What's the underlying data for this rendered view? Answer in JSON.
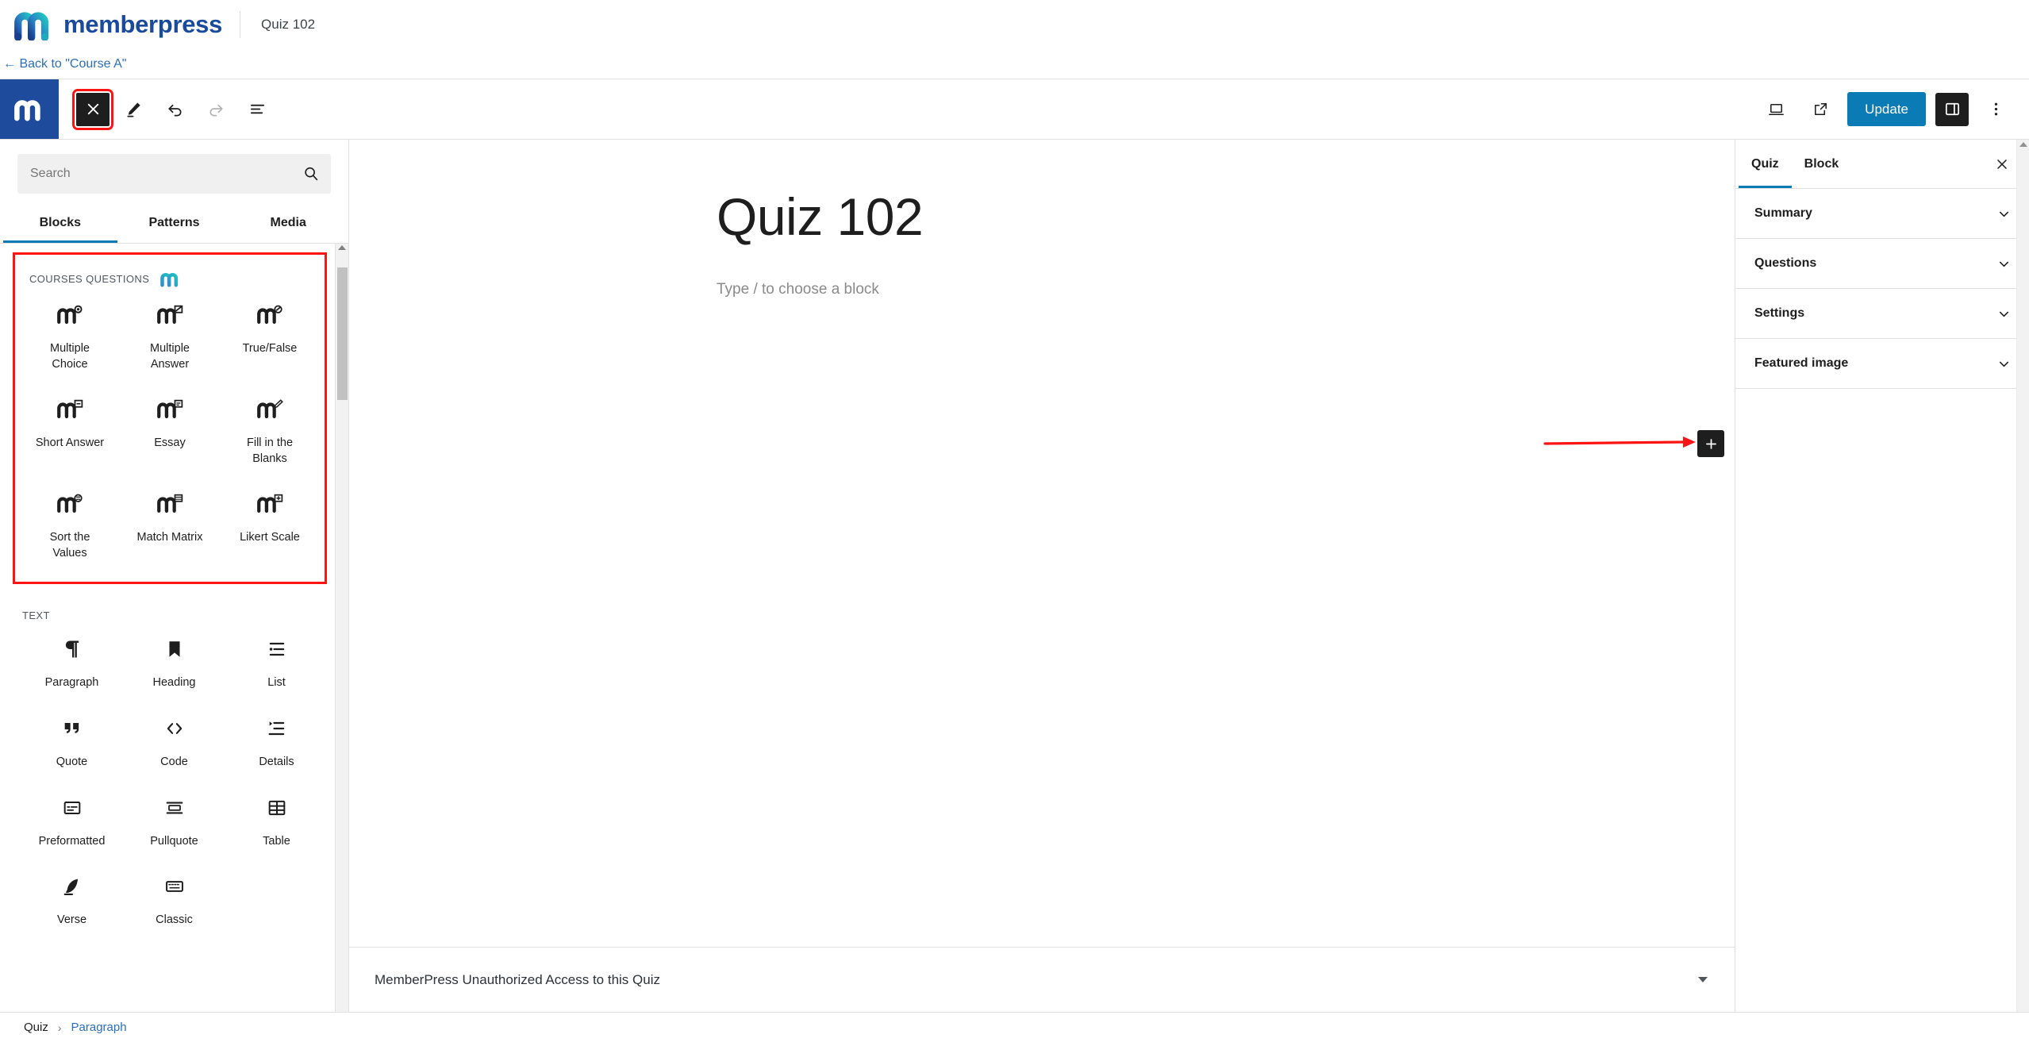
{
  "brand": {
    "name": "memberpress",
    "doc_title": "Quiz 102",
    "back_link": "← Back to \"Course A\"",
    "logo_blue": "#1a4a9c",
    "logo_teal": "#1fc1c0",
    "accent_blue": "#0b7bb5",
    "annotation_red": "#ff1414"
  },
  "editor_toolbar": {
    "close_icon": "close-icon",
    "tools_icon": "pencil-icon",
    "undo_icon": "undo-icon",
    "redo_icon": "redo-icon",
    "list_view_icon": "document-overview-icon",
    "preview_icon": "desktop-preview-icon",
    "view_icon": "external-link-icon",
    "update_label": "Update",
    "settings_toggle_icon": "settings-sidebar-icon",
    "options_icon": "more-options-icon"
  },
  "inserter": {
    "search": {
      "value": "",
      "placeholder": "Search",
      "icon": "search-icon"
    },
    "tabs": [
      {
        "label": "Blocks",
        "active": true
      },
      {
        "label": "Patterns",
        "active": false
      },
      {
        "label": "Media",
        "active": false
      }
    ],
    "sections": [
      {
        "title": "COURSES QUESTIONS",
        "has_logo": true,
        "highlighted": true,
        "blocks": [
          {
            "label": "Multiple Choice",
            "icon": "mp-multiple-choice-icon"
          },
          {
            "label": "Multiple Answer",
            "icon": "mp-multiple-answer-icon"
          },
          {
            "label": "True/False",
            "icon": "mp-true-false-icon"
          },
          {
            "label": "Short Answer",
            "icon": "mp-short-answer-icon"
          },
          {
            "label": "Essay",
            "icon": "mp-essay-icon"
          },
          {
            "label": "Fill in the Blanks",
            "icon": "mp-fill-in-the-blanks-icon"
          },
          {
            "label": "Sort the Values",
            "icon": "mp-sort-the-values-icon"
          },
          {
            "label": "Match Matrix",
            "icon": "mp-match-matrix-icon"
          },
          {
            "label": "Likert Scale",
            "icon": "mp-likert-scale-icon"
          }
        ]
      },
      {
        "title": "TEXT",
        "has_logo": false,
        "highlighted": false,
        "blocks": [
          {
            "label": "Paragraph",
            "icon": "paragraph-icon"
          },
          {
            "label": "Heading",
            "icon": "heading-icon"
          },
          {
            "label": "List",
            "icon": "list-icon"
          },
          {
            "label": "Quote",
            "icon": "quote-icon"
          },
          {
            "label": "Code",
            "icon": "code-icon"
          },
          {
            "label": "Details",
            "icon": "details-icon"
          },
          {
            "label": "Preformatted",
            "icon": "preformatted-icon"
          },
          {
            "label": "Pullquote",
            "icon": "pullquote-icon"
          },
          {
            "label": "Table",
            "icon": "table-icon"
          },
          {
            "label": "Verse",
            "icon": "verse-icon"
          },
          {
            "label": "Classic",
            "icon": "classic-icon"
          }
        ]
      }
    ]
  },
  "canvas": {
    "title": "Quiz 102",
    "paragraph_placeholder": "Type / to choose a block",
    "add_block_icon": "plus-icon",
    "annotation": "red-arrow-annotation",
    "footer_text": "MemberPress Unauthorized Access to this Quiz",
    "footer_caret": "caret-down-icon"
  },
  "settings_sidebar": {
    "tabs": [
      {
        "label": "Quiz",
        "active": true
      },
      {
        "label": "Block",
        "active": false
      }
    ],
    "close_icon": "close-icon",
    "panels": [
      {
        "label": "Summary",
        "icon": "chevron-down-icon"
      },
      {
        "label": "Questions",
        "icon": "chevron-down-icon"
      },
      {
        "label": "Settings",
        "icon": "chevron-down-icon"
      },
      {
        "label": "Featured image",
        "icon": "chevron-down-icon"
      }
    ]
  },
  "breadcrumb": {
    "items": [
      "Quiz",
      "Paragraph"
    ],
    "separator": "›"
  }
}
